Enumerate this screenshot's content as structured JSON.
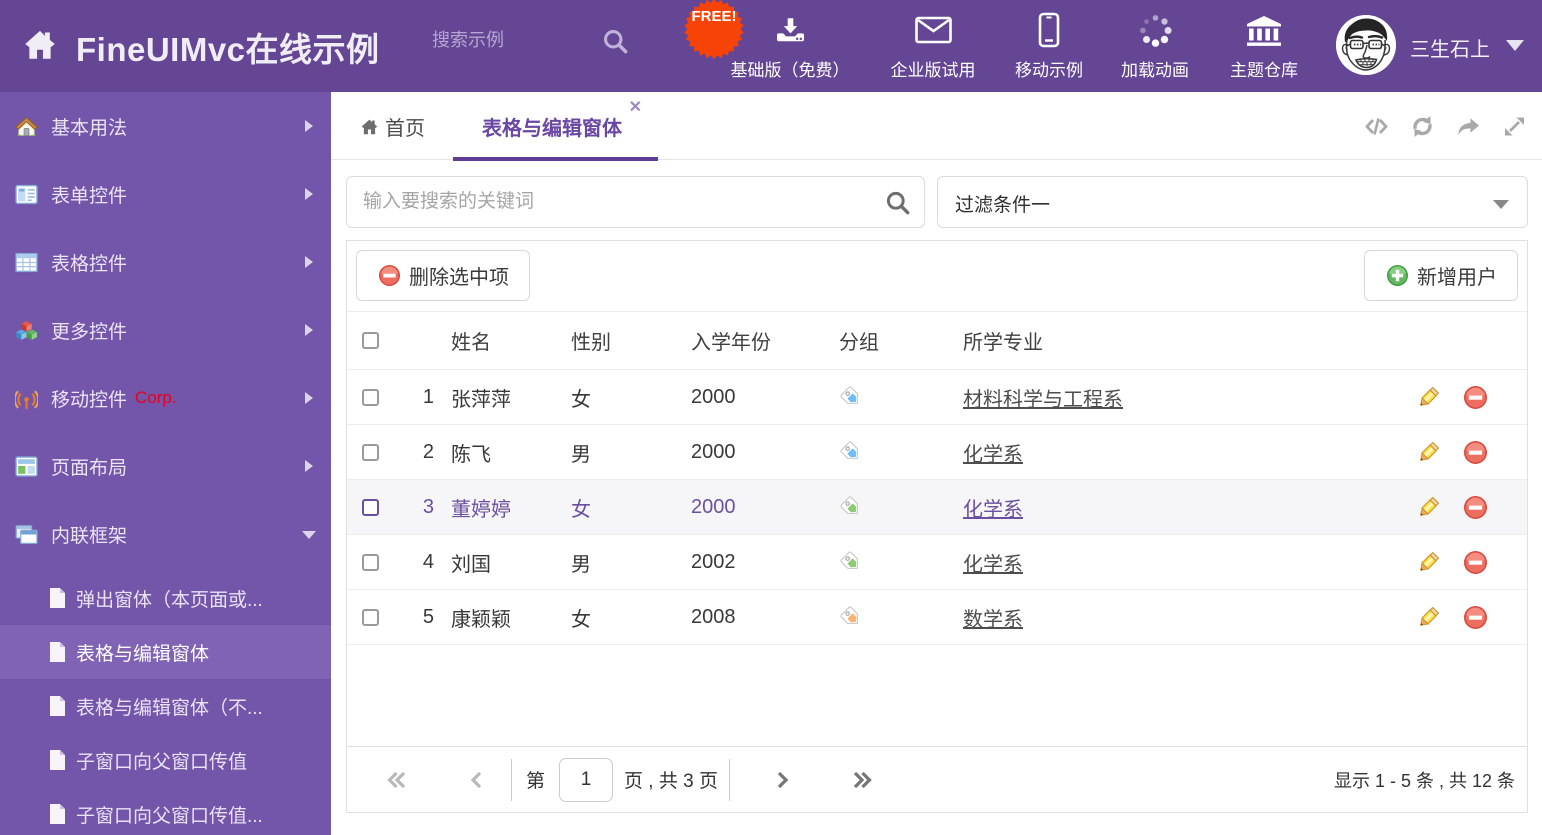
{
  "theme": {
    "header_bg": "#644694",
    "sidebar_bg": "#7355a9",
    "sidebar_active_bg": "#8163b5",
    "accent_purple": "#6947a3",
    "tab_underline": "#5e3d96",
    "free_badge_color": "#f84306",
    "delete_icon_color": "#dd4b43",
    "add_icon_color": "#46a546",
    "selected_row_bg": "#f4f3f6",
    "selected_row_text": "#7a57ad"
  },
  "header": {
    "title": "FineUIMvc在线示例",
    "search_placeholder": "搜索示例",
    "free_badge": "FREE!",
    "nav_items": [
      {
        "icon": "download-icon",
        "label": "基础版（免费）"
      },
      {
        "icon": "envelope-icon",
        "label": "企业版试用"
      },
      {
        "icon": "mobile-icon",
        "label": "移动示例"
      },
      {
        "icon": "spinner-icon",
        "label": "加载动画"
      },
      {
        "icon": "bank-icon",
        "label": "主题仓库"
      }
    ],
    "user": {
      "name": "三生石上"
    }
  },
  "sidebar": {
    "items": [
      {
        "label": "基本用法",
        "icon": "home-icon"
      },
      {
        "label": "表单控件",
        "icon": "form-icon"
      },
      {
        "label": "表格控件",
        "icon": "grid-icon"
      },
      {
        "label": "更多控件",
        "icon": "cubes-icon"
      },
      {
        "label": "移动控件",
        "badge": "Corp.",
        "icon": "antenna-icon"
      },
      {
        "label": "页面布局",
        "icon": "layout-icon"
      },
      {
        "label": "内联框架",
        "icon": "frames-icon",
        "expanded": true
      }
    ],
    "subitems": [
      {
        "label": "弹出窗体（本页面或..."
      },
      {
        "label": "表格与编辑窗体",
        "active": true
      },
      {
        "label": "表格与编辑窗体（不..."
      },
      {
        "label": "子窗口向父窗口传值"
      },
      {
        "label": "子窗口向父窗口传值..."
      }
    ]
  },
  "tabs": {
    "home_label": "首页",
    "active_label": "表格与编辑窗体",
    "close": "✕"
  },
  "filter": {
    "search_placeholder": "输入要搜索的关键词",
    "dropdown_value": "过滤条件一"
  },
  "toolbar": {
    "delete_label": "删除选中项",
    "add_label": "新增用户"
  },
  "table": {
    "columns": {
      "name": "姓名",
      "gender": "性别",
      "year": "入学年份",
      "group": "分组",
      "major": "所学专业"
    },
    "rows": [
      {
        "num": "1",
        "name": "张萍萍",
        "gender": "女",
        "year": "2000",
        "tag": "blue",
        "major": "材料科学与工程系",
        "selected": false
      },
      {
        "num": "2",
        "name": "陈飞",
        "gender": "男",
        "year": "2000",
        "tag": "blue",
        "major": "化学系",
        "selected": false
      },
      {
        "num": "3",
        "name": "董婷婷",
        "gender": "女",
        "year": "2000",
        "tag": "green",
        "major": "化学系",
        "selected": true
      },
      {
        "num": "4",
        "name": "刘国",
        "gender": "男",
        "year": "2002",
        "tag": "green",
        "major": "化学系",
        "selected": false
      },
      {
        "num": "5",
        "name": "康颖颖",
        "gender": "女",
        "year": "2008",
        "tag": "orange",
        "major": "数学系",
        "selected": false
      }
    ]
  },
  "pagination": {
    "page_prefix": "第",
    "page_value": "1",
    "page_suffix": "页 , 共 3 页",
    "summary": "显示 1 - 5 条 , 共 12 条"
  }
}
